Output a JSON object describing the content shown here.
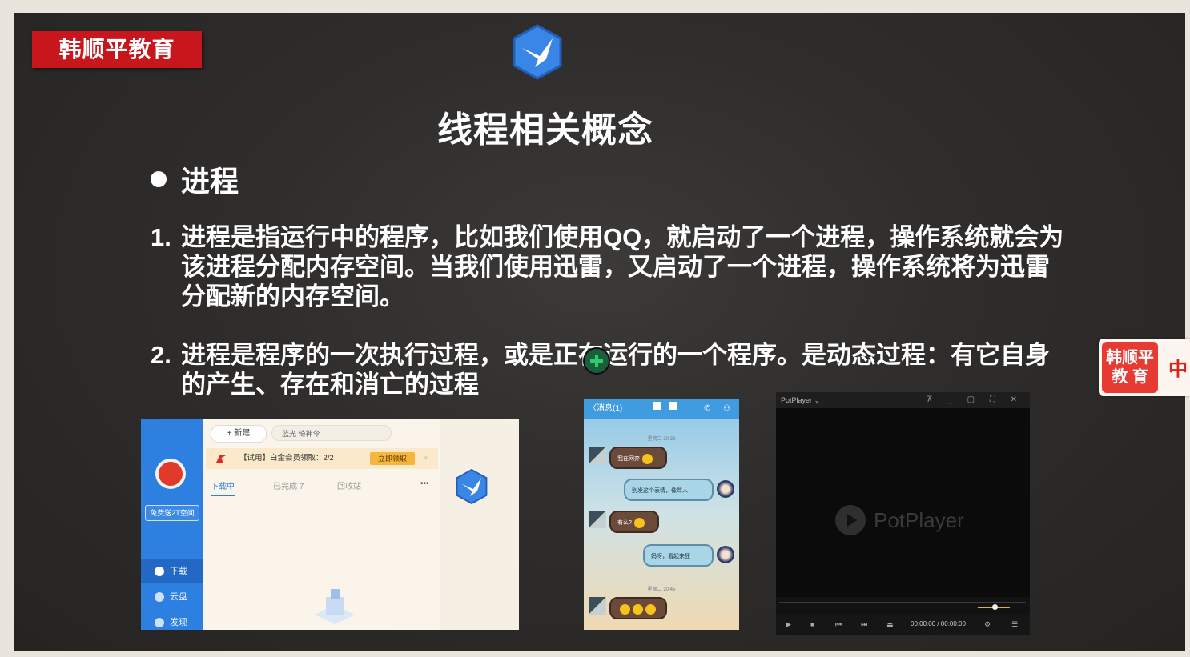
{
  "brand": "韩顺平教育",
  "title": "线程相关概念",
  "bullet": "进程",
  "items": [
    {
      "num": "1.",
      "text": "进程是指运行中的程序，比如我们使用QQ，就启动了一个进程，操作系统就会为该进程分配内存空间。当我们使用迅雷，又启动了一个进程，操作系统将为迅雷分配新的内存空间。"
    },
    {
      "num": "2.",
      "text": "进程是程序的一次执行过程，或是正在运行的一个程序。是动态过程：有它自身的产生、存在和消亡的过程"
    }
  ],
  "thunder": {
    "new_label": "+ 新建",
    "search_placeholder": "蓝光  倚神令",
    "promo_text": "【试用】白金会员领取：2/2",
    "promo_button": "立即领取",
    "promo_close": "×",
    "free_label": "免费送2T空间",
    "tabs": [
      "下载中",
      "已完成 7",
      "回收站",
      "•••"
    ],
    "nav": [
      "下载",
      "云盘",
      "发现"
    ]
  },
  "chat": {
    "header": "〈消息(1)",
    "time1": "星期二 20:36",
    "time2": "星期二 20:45",
    "messages": [
      "我在网奔",
      "别发这个表情，像骂人",
      "有么?",
      "妈呀，看起来狂"
    ]
  },
  "potplayer": {
    "title": "PotPlayer ⌄",
    "window_controls": "⊼ _ ▢ ⛶ ✕",
    "logo_text": "PotPlayer",
    "time": "00:00:00  /  00:00:00"
  },
  "widget": {
    "line1": "韩顺平",
    "line2": "教  育",
    "char": "中"
  },
  "colors": {
    "brand_red": "#c8161d",
    "accent_blue": "#2d7fe0"
  }
}
